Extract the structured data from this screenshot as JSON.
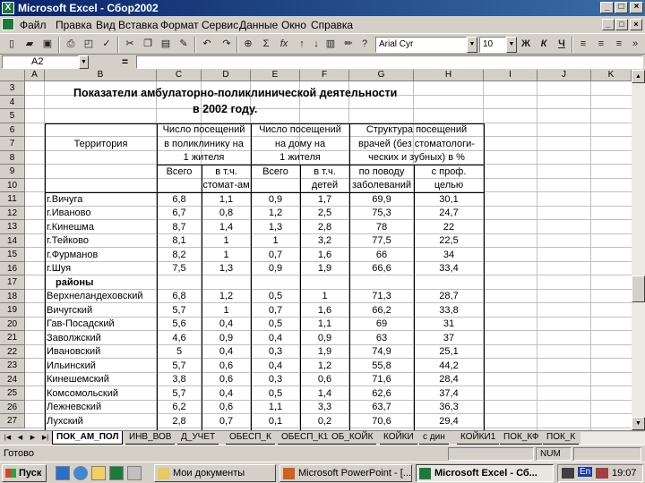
{
  "window": {
    "title": "Microsoft Excel - Сбор2002"
  },
  "menu": [
    "Файл",
    "Правка",
    "Вид",
    "Вставка",
    "Формат",
    "Сервис",
    "Данные",
    "Окно",
    "Справка"
  ],
  "toolbar": {
    "font_name": "Arial Cyr",
    "font_size": "10",
    "bold": "Ж",
    "italic": "К",
    "underline": "Ч",
    "sum": "Σ",
    "fx": "fx"
  },
  "formula": {
    "cell_ref": "A2",
    "equals": "=",
    "value": ""
  },
  "columns": [
    "A",
    "B",
    "C",
    "D",
    "E",
    "F",
    "G",
    "H",
    "I",
    "J",
    "K"
  ],
  "row_numbers": [
    "3",
    "4",
    "5",
    "6",
    "7",
    "8",
    "9",
    "10",
    "11",
    "12",
    "13",
    "14",
    "15",
    "16",
    "17",
    "18",
    "19",
    "20",
    "21",
    "22",
    "23",
    "24",
    "25",
    "26",
    "27"
  ],
  "sheet_title": {
    "line1": "Показатели амбулаторно-поликлинической деятельности",
    "line2": "в 2002 году."
  },
  "headers": {
    "territory": "Территория",
    "visits": [
      "Число посещений",
      "в поликлинику на",
      "1 жителя"
    ],
    "home": [
      "Число посещений",
      "на дому на",
      "1 жителя"
    ],
    "structure": [
      "Структура посещений",
      "врачей (без стоматологи-",
      "ческих и зубных) в %"
    ],
    "total_1": "Всего",
    "incl_stom": [
      "в т.ч.",
      "стомат-ам"
    ],
    "total_2": "Всего",
    "incl_child": [
      "в т.ч.",
      "детей"
    ],
    "by_illness": [
      "по поводу",
      "заболеваний"
    ],
    "prof": [
      "с проф.",
      "целью"
    ]
  },
  "rows": [
    {
      "name": "г.Вичуга",
      "v": [
        "6,8",
        "1,1",
        "0,9",
        "1,7",
        "69,9",
        "30,1"
      ]
    },
    {
      "name": "г.Иваново",
      "v": [
        "6,7",
        "0,8",
        "1,2",
        "2,5",
        "75,3",
        "24,7"
      ]
    },
    {
      "name": "г.Кинешма",
      "v": [
        "8,7",
        "1,4",
        "1,3",
        "2,8",
        "78",
        "22"
      ]
    },
    {
      "name": "г.Тейково",
      "v": [
        "8,1",
        "1",
        "1",
        "3,2",
        "77,5",
        "22,5"
      ]
    },
    {
      "name": "г.Фурманов",
      "v": [
        "8,2",
        "1",
        "0,7",
        "1,6",
        "66",
        "34"
      ]
    },
    {
      "name": "г.Шуя",
      "v": [
        "7,5",
        "1,3",
        "0,9",
        "1,9",
        "66,6",
        "33,4"
      ]
    },
    {
      "name": "районы",
      "v": [
        "",
        "",
        "",
        "",
        "",
        ""
      ],
      "bold": true
    },
    {
      "name": "Верхнеландеховский",
      "v": [
        "6,8",
        "1,2",
        "0,5",
        "1",
        "71,3",
        "28,7"
      ]
    },
    {
      "name": "Вичугский",
      "v": [
        "5,7",
        "1",
        "0,7",
        "1,6",
        "66,2",
        "33,8"
      ]
    },
    {
      "name": "Гав-Посадский",
      "v": [
        "5,6",
        "0,4",
        "0,5",
        "1,1",
        "69",
        "31"
      ]
    },
    {
      "name": "Заволжский",
      "v": [
        "4,6",
        "0,9",
        "0,4",
        "0,9",
        "63",
        "37"
      ]
    },
    {
      "name": "Ивановский",
      "v": [
        "5",
        "0,4",
        "0,3",
        "1,9",
        "74,9",
        "25,1"
      ]
    },
    {
      "name": "Ильинский",
      "v": [
        "5,7",
        "0,6",
        "0,4",
        "1,2",
        "55,8",
        "44,2"
      ]
    },
    {
      "name": "Кинешемский",
      "v": [
        "3,8",
        "0,6",
        "0,3",
        "0,6",
        "71,6",
        "28,4"
      ]
    },
    {
      "name": "Комсомольский",
      "v": [
        "5,7",
        "0,4",
        "0,5",
        "1,4",
        "62,6",
        "37,4"
      ]
    },
    {
      "name": "Лежневский",
      "v": [
        "6,2",
        "0,6",
        "1,1",
        "3,3",
        "63,7",
        "36,3"
      ]
    },
    {
      "name": "Лухский",
      "v": [
        "2,8",
        "0,7",
        "0,1",
        "0,2",
        "70,6",
        "29,4"
      ]
    }
  ],
  "sheet_tabs": [
    "ПОК_АМ_ПОЛ",
    "ИНВ_ВОВ",
    "Д_УЧЕТ",
    "ОБЕСП_К",
    "ОБЕСП_К1",
    "ОБ_КОЙК",
    "КОЙКИ",
    "с дин",
    "КОЙКИ1",
    "ПОК_КФ",
    "ПОК_К"
  ],
  "status": {
    "ready": "Готово",
    "num": "NUM"
  },
  "taskbar": {
    "start": "Пуск",
    "tasks": [
      "Мои документы",
      "Microsoft PowerPoint - [...",
      "Microsoft Excel - Сб..."
    ],
    "lang": "En",
    "time": "19:07"
  }
}
